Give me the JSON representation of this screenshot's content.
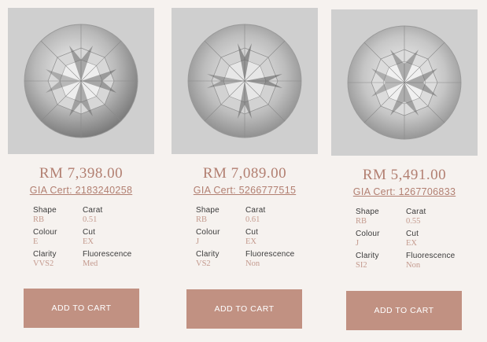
{
  "labels": {
    "shape": "Shape",
    "carat": "Carat",
    "colour": "Colour",
    "cut": "Cut",
    "clarity": "Clarity",
    "fluorescence": "Fluorescence",
    "add_to_cart": "ADD TO CART"
  },
  "products": [
    {
      "price": "RM 7,398.00",
      "cert": "GIA Cert: 2183240258",
      "shape": "RB",
      "carat": "0.51",
      "colour": "E",
      "cut": "EX",
      "clarity": "VVS2",
      "fluorescence": "Med"
    },
    {
      "price": "RM 7,089.00",
      "cert": "GIA Cert: 5266777515",
      "shape": "RB",
      "carat": "0.61",
      "colour": "J",
      "cut": "EX",
      "clarity": "VS2",
      "fluorescence": "Non"
    },
    {
      "price": "RM 5,491.00",
      "cert": "GIA Cert: 1267706833",
      "shape": "RB",
      "carat": "0.55",
      "colour": "J",
      "cut": "EX",
      "clarity": "SI2",
      "fluorescence": "Non"
    }
  ]
}
